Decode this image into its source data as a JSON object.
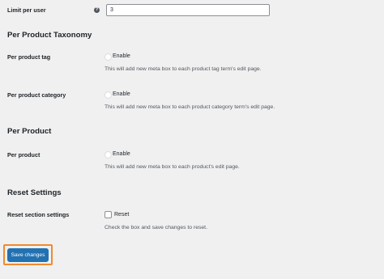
{
  "limit_per_user": {
    "label": "Limit per user",
    "help_icon_text": "?",
    "value": "3"
  },
  "sections": {
    "taxonomy_title": "Per Product Taxonomy",
    "product_title": "Per Product",
    "reset_title": "Reset Settings"
  },
  "per_product_tag": {
    "label": "Per product tag",
    "option": "Enable",
    "description": "This will add new meta box to each product tag term's edit page."
  },
  "per_product_category": {
    "label": "Per product category",
    "option": "Enable",
    "description": "This will add new meta box to each product category term's edit page."
  },
  "per_product": {
    "label": "Per product",
    "option": "Enable",
    "description": "This will add new meta box to each product's edit page."
  },
  "reset": {
    "label": "Reset section settings",
    "option": "Reset",
    "description": "Check the box and save changes to reset."
  },
  "save_button": "Save changes",
  "colors": {
    "primary": "#2271b1",
    "highlight": "#ef8a2e",
    "background": "#f0f0f1"
  }
}
